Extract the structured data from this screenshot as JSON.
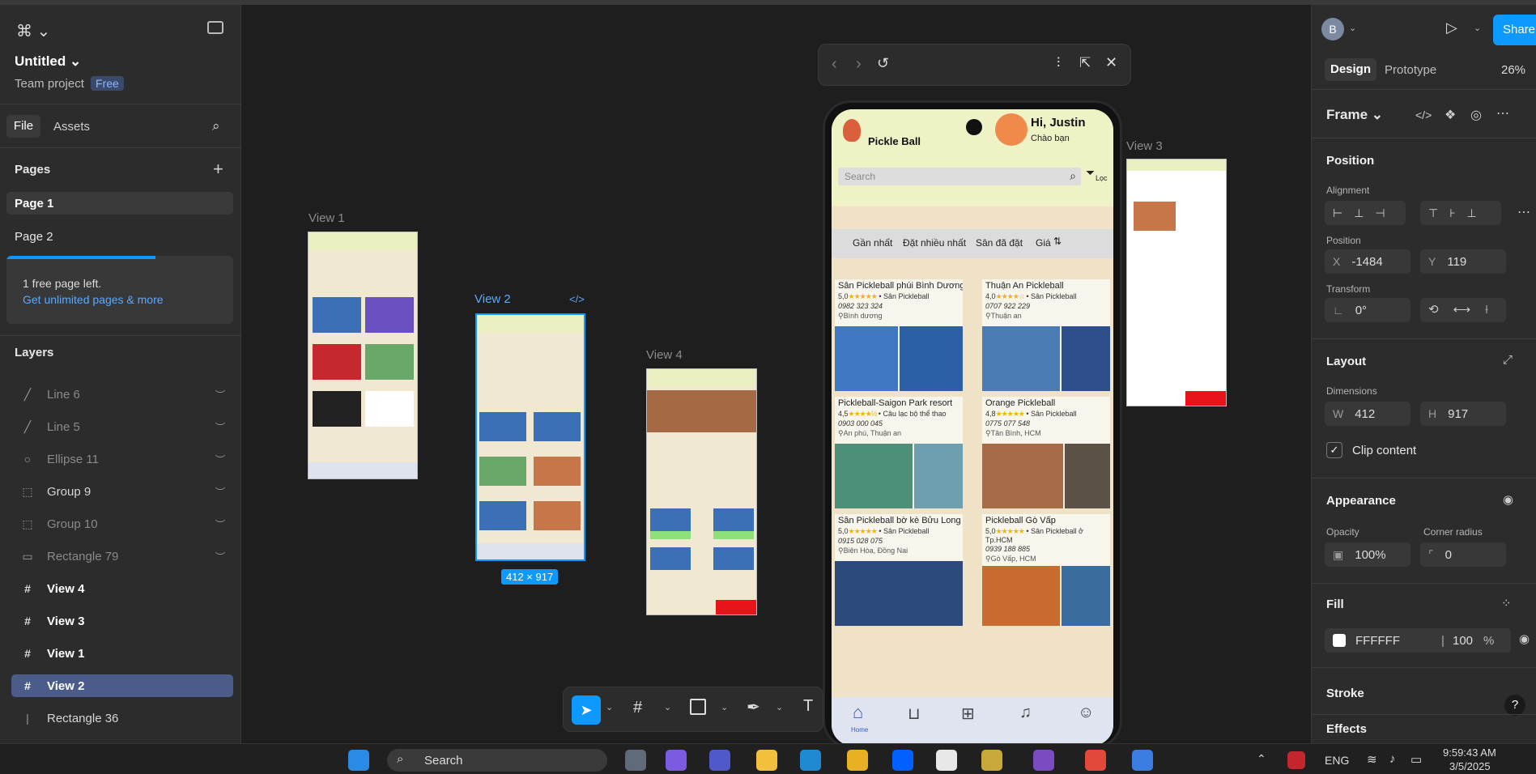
{
  "left_panel": {
    "file_name": "Untitled",
    "team": "Team project",
    "plan_badge": "Free",
    "tab_file": "File",
    "tab_assets": "Assets",
    "pages_title": "Pages",
    "pages": [
      "Page 1",
      "Page 2"
    ],
    "limit_text": "1 free page left.",
    "limit_link": "Get unlimited pages & more",
    "layers_title": "Layers",
    "layers": [
      {
        "name": "Line 6",
        "icon": "line-icon"
      },
      {
        "name": "Line 5",
        "icon": "line-icon"
      },
      {
        "name": "Ellipse 11",
        "icon": "ellipse-icon"
      },
      {
        "name": "Group 9",
        "icon": "group-icon"
      },
      {
        "name": "Group 10",
        "icon": "group-icon"
      },
      {
        "name": "Rectangle 79",
        "icon": "rectangle-icon"
      },
      {
        "name": "View 4",
        "icon": "frame-icon"
      },
      {
        "name": "View 3",
        "icon": "frame-icon"
      },
      {
        "name": "View 1",
        "icon": "frame-icon"
      },
      {
        "name": "View 2",
        "icon": "frame-icon"
      },
      {
        "name": "Rectangle 36",
        "icon": "rectangle-icon"
      }
    ]
  },
  "canvas": {
    "frames": [
      "View 1",
      "View 2",
      "View 4",
      "View 3"
    ],
    "size_badge": "412 × 917",
    "prototype_app": {
      "brand": "Pickle Ball",
      "greeting": "Hi, Justin",
      "sub_greeting": "Chào bạn",
      "search_placeholder": "Search",
      "filter_label": "Lọc",
      "sort_tabs": [
        "Gần nhất",
        "Đặt nhiều nhất",
        "Sân đã đặt",
        "Giá"
      ],
      "courts": [
        {
          "name": "Sân Pickleball phúi Bình Dương",
          "rating": "5,0",
          "type": "Sân Pickleball",
          "phone": "0982 323 324",
          "location": "Bình dương"
        },
        {
          "name": "Thuận An Pickleball",
          "rating": "4,0",
          "type": "Sân Pickleball",
          "phone": "0707 922 229",
          "location": "Thuận an"
        },
        {
          "name": "Pickleball-Saigon Park resort",
          "rating": "4,5",
          "type": "Câu lạc bộ thể thao",
          "phone": "0903 000 045",
          "location": "An phú, Thuận an"
        },
        {
          "name": "Orange Pickleball",
          "rating": "4,8",
          "type": "Sân Pickleball",
          "phone": "0775 077 548",
          "location": "Tân Bình, HCM"
        },
        {
          "name": "Sân Pickleball bờ kè Bửu Long",
          "rating": "5,0",
          "type": "Sân Pickleball",
          "phone": "0915 028 075",
          "location": "Biên Hòa, Đồng Nai"
        },
        {
          "name": "Pickleball Gò Vấp",
          "rating": "5,0",
          "type": "Sân Pickleball ở Tp.HCM",
          "phone": "0939 188 885",
          "location": "Gò Vấp, HCM"
        }
      ],
      "nav_home": "Home"
    }
  },
  "right_panel": {
    "avatar_letter": "B",
    "share": "Share",
    "tab_design": "Design",
    "tab_prototype": "Prototype",
    "zoom": "26%",
    "frame_label": "Frame",
    "position_title": "Position",
    "alignment_label": "Alignment",
    "position_label": "Position",
    "x_key": "X",
    "x_value": "-1484",
    "y_key": "Y",
    "y_value": "119",
    "transform_label": "Transform",
    "rotation": "0°",
    "layout_title": "Layout",
    "dimensions_label": "Dimensions",
    "w_key": "W",
    "w_value": "412",
    "h_key": "H",
    "h_value": "917",
    "clip_content": "Clip content",
    "appearance_title": "Appearance",
    "opacity_label": "Opacity",
    "opacity_value": "100%",
    "corner_label": "Corner radius",
    "corner_value": "0",
    "fill_title": "Fill",
    "fill_hex": "FFFFFF",
    "fill_opacity": "100",
    "fill_pct": "%",
    "stroke_title": "Stroke",
    "effects_title": "Effects",
    "help": "?"
  },
  "taskbar": {
    "search": "Search",
    "lang": "ENG",
    "time": "9:59:43 AM",
    "date": "3/5/2025"
  },
  "colors": {
    "accent": "#0d99ff",
    "selection": "#4b5c8a",
    "phone_bg": "#efe2c6"
  }
}
